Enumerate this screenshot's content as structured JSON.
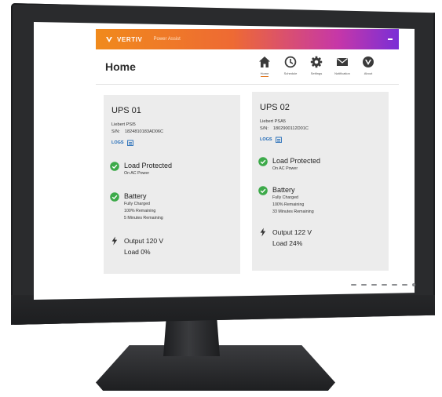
{
  "app": {
    "brand": "VERTIV",
    "product": "Power Assist",
    "page_title": "Home",
    "accent_colors": [
      "#f08a1c",
      "#ee6a33",
      "#c637a8",
      "#7a2fd6"
    ]
  },
  "nav": [
    {
      "label": "Home",
      "icon": "home-icon",
      "active": true
    },
    {
      "label": "Schedule",
      "icon": "clock-icon"
    },
    {
      "label": "Settings",
      "icon": "gear-icon"
    },
    {
      "label": "Notification",
      "icon": "envelope-icon"
    },
    {
      "label": "About",
      "icon": "vertiv-logo-icon"
    }
  ],
  "ups": [
    {
      "name": "UPS 01",
      "model": "Liebert PSI5",
      "sn_label": "S/N:",
      "serial": "1824810183AD06C",
      "logs_label": "LOGS",
      "load_protected": "Load Protected",
      "load_protected_sub": "On AC Power",
      "battery": "Battery",
      "battery_lines": [
        "Fully Charged",
        "100% Remaining",
        "5 Minutes Remaining"
      ],
      "output": "Output 120 V",
      "load": "Load 0%"
    },
    {
      "name": "UPS 02",
      "model": "Liebert PSA5",
      "sn_label": "S/N:",
      "serial": "1802900112D01C",
      "logs_label": "LOGS",
      "load_protected": "Load Protected",
      "load_protected_sub": "On AC Power",
      "battery": "Battery",
      "battery_lines": [
        "Fully Charged",
        "100% Remaining",
        "33 Minutes Remaining"
      ],
      "output": "Output 122 V",
      "load": "Load 24%"
    }
  ],
  "status_color": "#3daa4a",
  "link_color": "#1a66b5"
}
